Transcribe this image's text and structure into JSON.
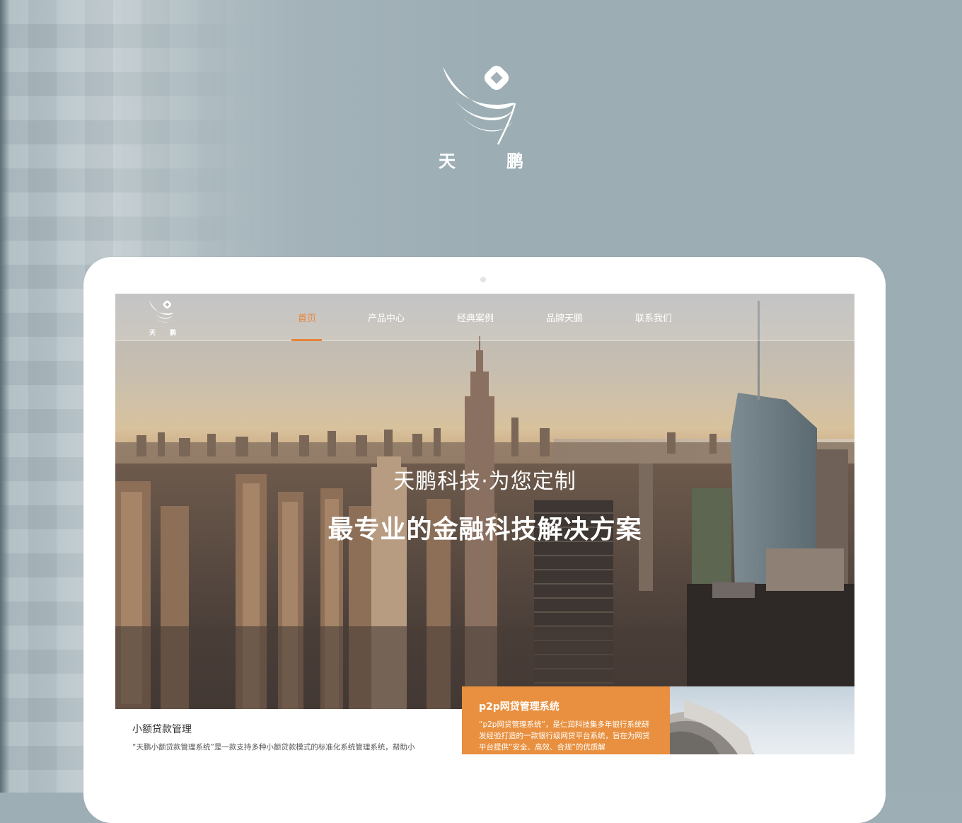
{
  "brand": {
    "name_char_1": "天",
    "name_char_2": "鹏",
    "accent_color": "#e8843a"
  },
  "nav": {
    "items": [
      {
        "label": "首页",
        "active": true
      },
      {
        "label": "产品中心",
        "active": false
      },
      {
        "label": "经典案例",
        "active": false
      },
      {
        "label": "品牌天鹏",
        "active": false
      },
      {
        "label": "联系我们",
        "active": false
      }
    ]
  },
  "hero": {
    "subtitle": "天鹏科技·为您定制",
    "title": "最专业的金融科技解决方案"
  },
  "cards": {
    "microloan": {
      "title": "小额贷款管理",
      "text": "“天鹏小额贷款管理系统”是一款支持多种小额贷款模式的标准化系统管理系统，帮助小"
    },
    "p2p": {
      "title": "p2p网贷管理系统",
      "text": "“p2p网贷管理系统”，是仁润科技集多年银行系统研发经验打造的一款银行级网贷平台系统，旨在为网贷平台提供“安全、高效、合规”的优质解",
      "color": "#e8903f"
    }
  }
}
